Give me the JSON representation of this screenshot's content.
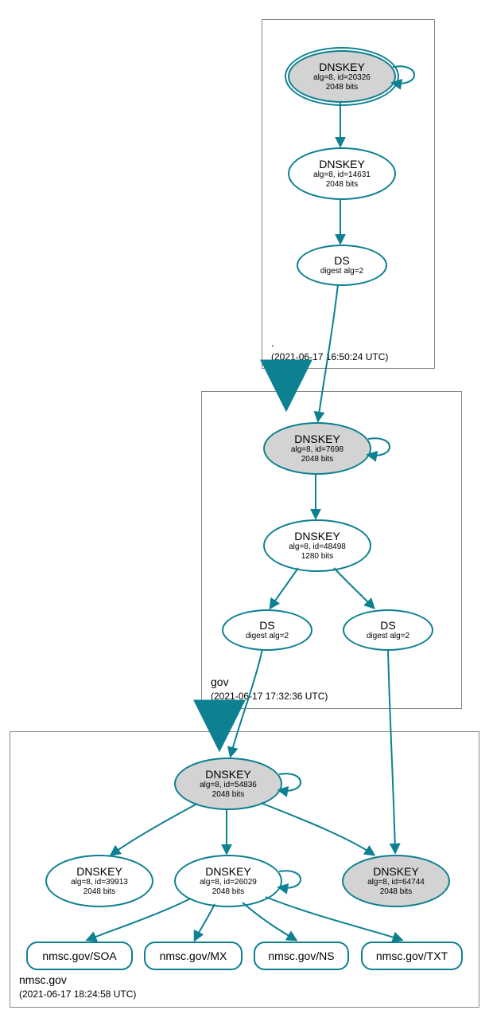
{
  "zones": [
    {
      "name": ".",
      "timestamp": "(2021-06-17 16:50:24 UTC)"
    },
    {
      "name": "gov",
      "timestamp": "(2021-06-17 17:32:36 UTC)"
    },
    {
      "name": "nmsc.gov",
      "timestamp": "(2021-06-17 18:24:58 UTC)"
    }
  ],
  "nodes": {
    "root_ksk": {
      "title": "DNSKEY",
      "line1": "alg=8, id=20326",
      "line2": "2048 bits"
    },
    "root_zsk": {
      "title": "DNSKEY",
      "line1": "alg=8, id=14631",
      "line2": "2048 bits"
    },
    "root_ds": {
      "title": "DS",
      "line1": "digest alg=2"
    },
    "gov_ksk": {
      "title": "DNSKEY",
      "line1": "alg=8, id=7698",
      "line2": "2048 bits"
    },
    "gov_zsk": {
      "title": "DNSKEY",
      "line1": "alg=8, id=48498",
      "line2": "1280 bits"
    },
    "gov_ds1": {
      "title": "DS",
      "line1": "digest alg=2"
    },
    "gov_ds2": {
      "title": "DS",
      "line1": "digest alg=2"
    },
    "nmsc_ksk": {
      "title": "DNSKEY",
      "line1": "alg=8, id=54836",
      "line2": "2048 bits"
    },
    "nmsc_k1": {
      "title": "DNSKEY",
      "line1": "alg=8, id=39913",
      "line2": "2048 bits"
    },
    "nmsc_k2": {
      "title": "DNSKEY",
      "line1": "alg=8, id=26029",
      "line2": "2048 bits"
    },
    "nmsc_k3": {
      "title": "DNSKEY",
      "line1": "alg=8, id=64744",
      "line2": "2048 bits"
    },
    "rr_soa": {
      "label": "nmsc.gov/SOA"
    },
    "rr_mx": {
      "label": "nmsc.gov/MX"
    },
    "rr_ns": {
      "label": "nmsc.gov/NS"
    },
    "rr_txt": {
      "label": "nmsc.gov/TXT"
    }
  },
  "colors": {
    "stroke": "#0d8091",
    "fill_grey": "#d3d3d3"
  },
  "chart_data": {
    "type": "diagram",
    "description": "DNSSEC chain of trust graph",
    "zones": [
      ".",
      "gov",
      "nmsc.gov"
    ],
    "edges": [
      {
        "from": "root_ksk",
        "to": "root_ksk",
        "kind": "self"
      },
      {
        "from": "root_ksk",
        "to": "root_zsk"
      },
      {
        "from": "root_zsk",
        "to": "root_ds"
      },
      {
        "from": "root_ds",
        "to": "gov_ksk"
      },
      {
        "from": ".zone",
        "to": "gov.zone",
        "kind": "zone-delegation"
      },
      {
        "from": "gov_ksk",
        "to": "gov_ksk",
        "kind": "self"
      },
      {
        "from": "gov_ksk",
        "to": "gov_zsk"
      },
      {
        "from": "gov_zsk",
        "to": "gov_ds1"
      },
      {
        "from": "gov_zsk",
        "to": "gov_ds2"
      },
      {
        "from": "gov_ds1",
        "to": "nmsc_ksk"
      },
      {
        "from": "gov_ds2",
        "to": "nmsc_k3"
      },
      {
        "from": "gov.zone",
        "to": "nmsc.gov.zone",
        "kind": "zone-delegation"
      },
      {
        "from": "nmsc_ksk",
        "to": "nmsc_ksk",
        "kind": "self"
      },
      {
        "from": "nmsc_ksk",
        "to": "nmsc_k1"
      },
      {
        "from": "nmsc_ksk",
        "to": "nmsc_k2"
      },
      {
        "from": "nmsc_ksk",
        "to": "nmsc_k3"
      },
      {
        "from": "nmsc_k2",
        "to": "nmsc_k2",
        "kind": "self"
      },
      {
        "from": "nmsc_k2",
        "to": "rr_soa"
      },
      {
        "from": "nmsc_k2",
        "to": "rr_mx"
      },
      {
        "from": "nmsc_k2",
        "to": "rr_ns"
      },
      {
        "from": "nmsc_k2",
        "to": "rr_txt"
      }
    ]
  }
}
